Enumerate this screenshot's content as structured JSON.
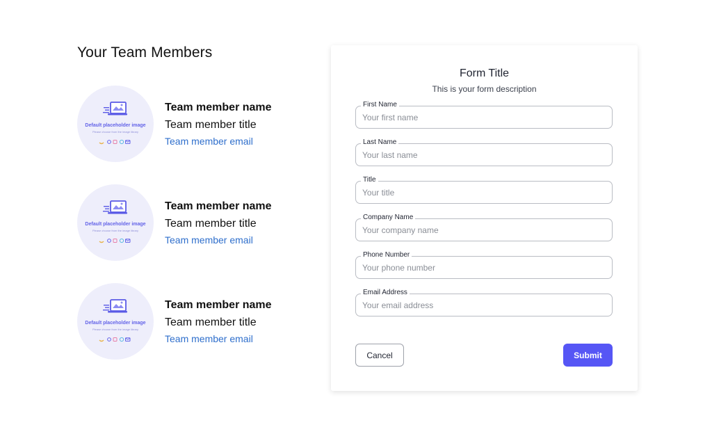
{
  "team": {
    "heading": "Your Team Members",
    "members": [
      {
        "placeholder_title": "Default placeholder image",
        "placeholder_sub": "Please choose from the image library",
        "name": "Team member name",
        "title": "Team member title",
        "email": "Team member email"
      },
      {
        "placeholder_title": "Default placeholder image",
        "placeholder_sub": "Please choose from the image library",
        "name": "Team member name",
        "title": "Team member title",
        "email": "Team member email"
      },
      {
        "placeholder_title": "Default placeholder image",
        "placeholder_sub": "Please choose from the image library",
        "name": "Team member name",
        "title": "Team member title",
        "email": "Team member email"
      }
    ]
  },
  "form": {
    "title": "Form Title",
    "description": "This is your form description",
    "fields": [
      {
        "label": "First Name",
        "placeholder": "Your first name",
        "value": ""
      },
      {
        "label": "Last Name",
        "placeholder": "Your last name",
        "value": ""
      },
      {
        "label": "Title",
        "placeholder": "Your title",
        "value": ""
      },
      {
        "label": "Company Name",
        "placeholder": "Your company name",
        "value": ""
      },
      {
        "label": "Phone Number",
        "placeholder": "Your phone number",
        "value": ""
      },
      {
        "label": "Email Address",
        "placeholder": "Your email address",
        "value": ""
      }
    ],
    "cancel_label": "Cancel",
    "submit_label": "Submit"
  },
  "colors": {
    "accent": "#5656f5",
    "link": "#2f6fcc",
    "avatar_bg": "#eeeefb",
    "placeholder_icon": "#6363e8"
  },
  "icons": [
    "laptop-image-icon",
    "link-icon",
    "gallery-icon",
    "box-icon",
    "circle-icon",
    "mail-icon"
  ]
}
